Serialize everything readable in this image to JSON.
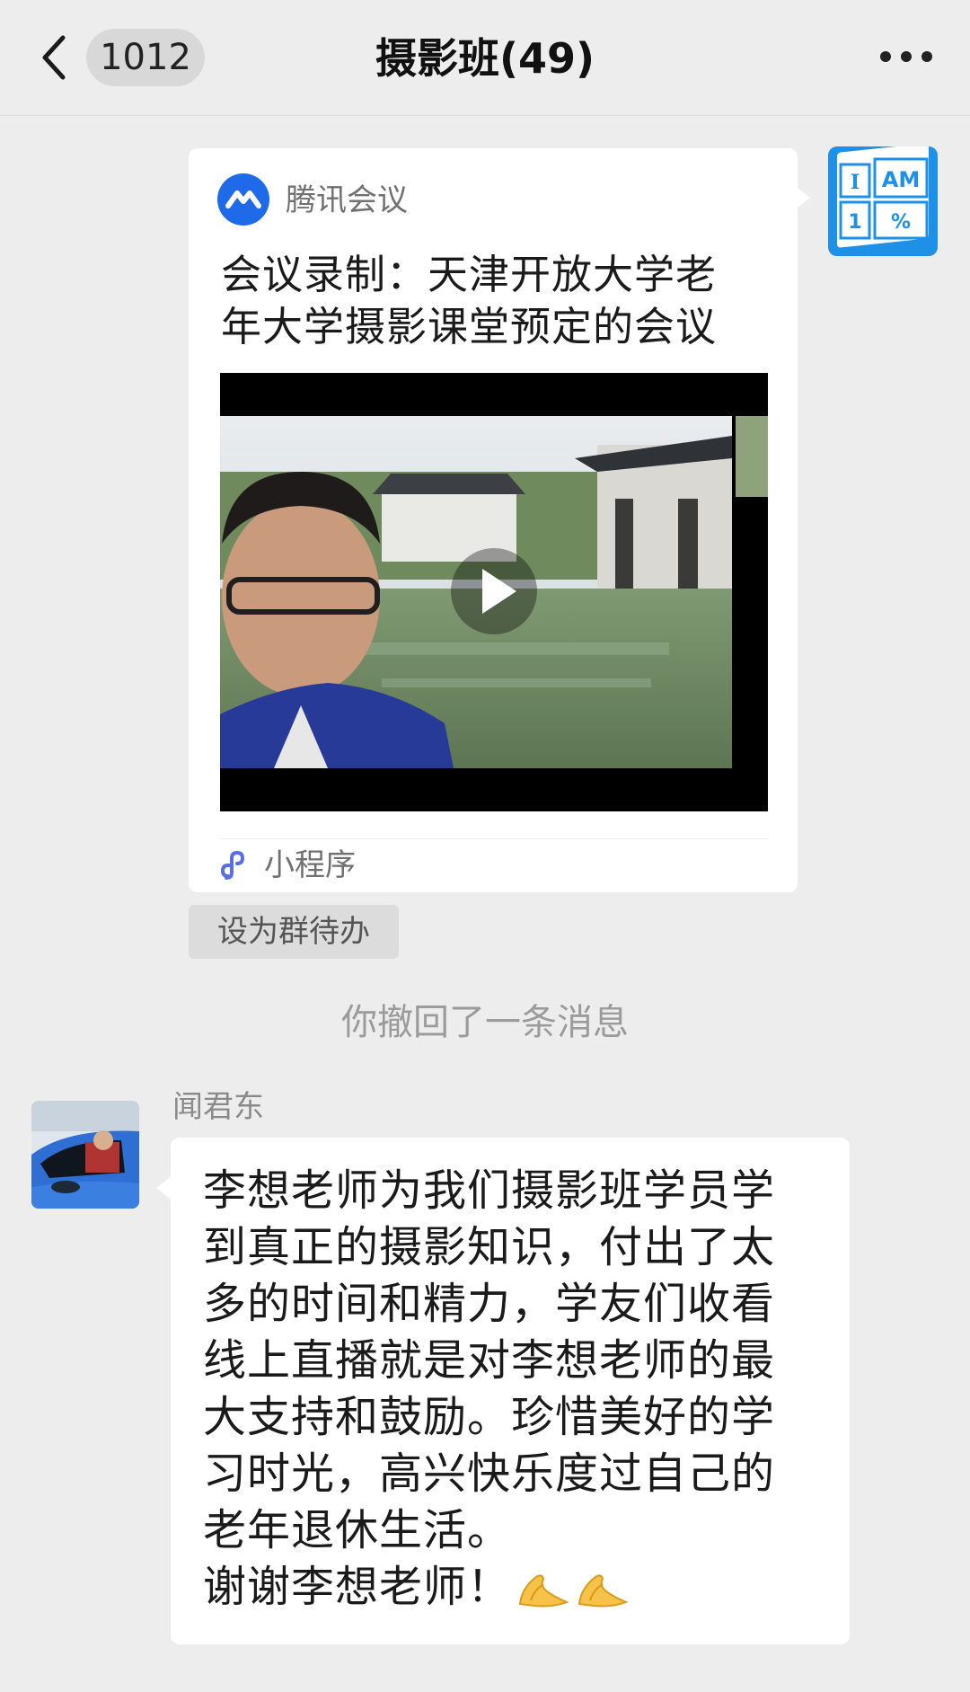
{
  "header": {
    "unread_count": "1012",
    "title": "摄影班(49)"
  },
  "mini_program_card": {
    "app_name": "腾讯会议",
    "title_line1": "会议录制：天津开放大学老",
    "title_line2": "年大学摄影课堂预定的会议",
    "footer_label": "小程序",
    "icons": {
      "app_logo": "tencent-meeting-logo",
      "play": "play-icon",
      "footer": "mini-program-icon"
    }
  },
  "self_avatar": {
    "texts": [
      "I",
      "AM",
      "1",
      "%"
    ]
  },
  "todo_button": {
    "label": "设为群待办"
  },
  "system_note": {
    "text": "你撤回了一条消息"
  },
  "incoming_message": {
    "sender": "闻君东",
    "lines": [
      "李想老师为我们摄影班学员学",
      "到真正的摄影知识，付出了太",
      "多的时间和精力，学友们收看",
      "线上直播就是对李想老师的最",
      "大支持和鼓励。珍惜美好的学",
      "习时光，高兴快乐度过自己的",
      "老年退休生活。",
      "谢谢李想老师！"
    ],
    "emoji": [
      "folded-hands-icon",
      "folded-hands-icon"
    ]
  },
  "colors": {
    "background": "#ededed",
    "bubble": "#ffffff",
    "accent_blue": "#1e90e8",
    "meeting_blue": "#1f6ae8"
  }
}
